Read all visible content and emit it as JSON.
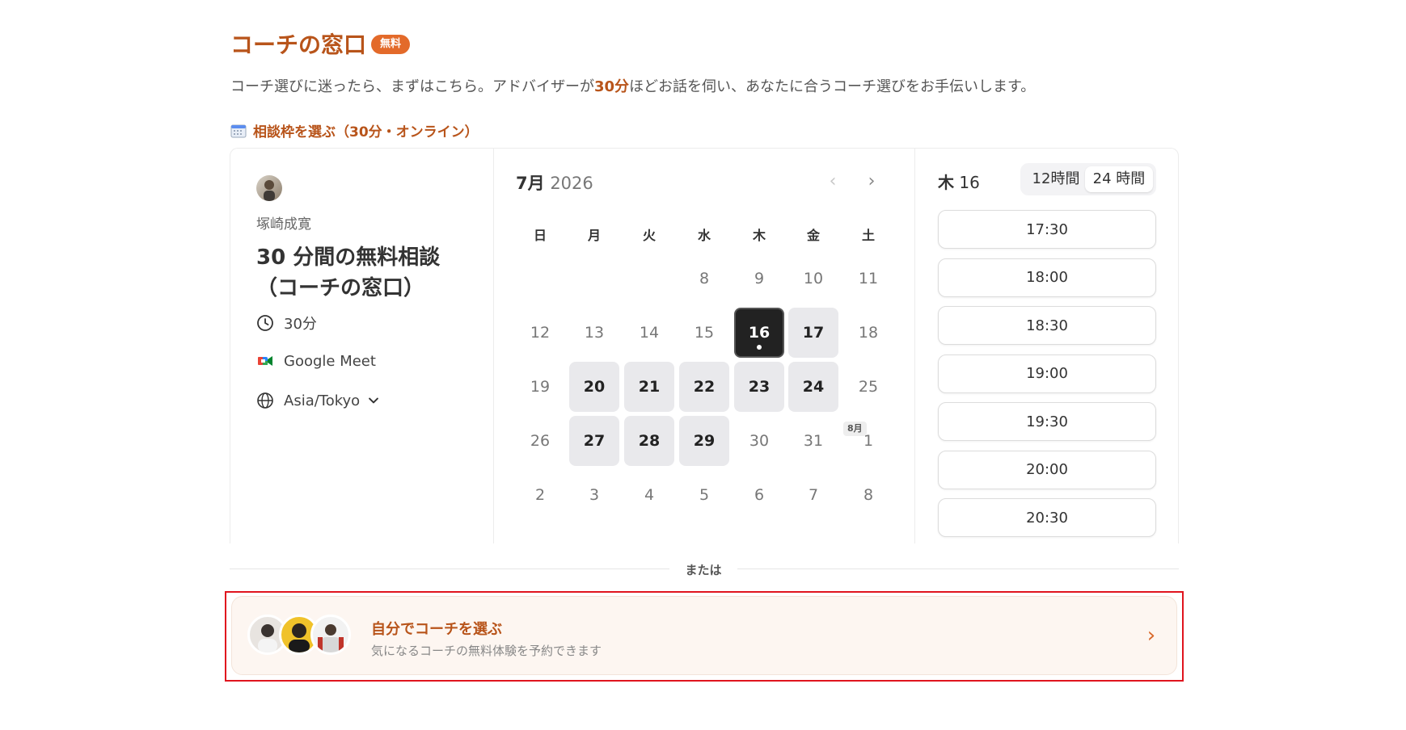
{
  "header": {
    "title": "コーチの窓口",
    "badge": "無料"
  },
  "intro": {
    "before": "コーチ選びに迷ったら、まずはこちら。アドバイザーが",
    "highlight": "30分",
    "after": "ほどお話を伺い、あなたに合うコーチ選びをお手伝いします。"
  },
  "section_label": "相談枠を選ぶ（30分・オンライン）",
  "event": {
    "coach_name": "塚崎成寛",
    "title": "30 分間の無料相談（コーチの窓口）",
    "duration": "30分",
    "location": "Google Meet",
    "timezone": "Asia/Tokyo"
  },
  "calendar": {
    "month": "7月",
    "year": "2026",
    "weekdays": [
      "日",
      "月",
      "火",
      "水",
      "木",
      "金",
      "土"
    ],
    "next_month_tag": "8月",
    "weeks": [
      [
        "",
        "",
        "",
        "8",
        "9",
        "10",
        "11"
      ],
      [
        "12",
        "13",
        "14",
        "15",
        "16",
        "17",
        "18"
      ],
      [
        "19",
        "20",
        "21",
        "22",
        "23",
        "24",
        "25"
      ],
      [
        "26",
        "27",
        "28",
        "29",
        "30",
        "31",
        "1"
      ],
      [
        "2",
        "3",
        "4",
        "5",
        "6",
        "7",
        "8"
      ]
    ],
    "available": [
      "17",
      "20",
      "21",
      "22",
      "23",
      "24",
      "27",
      "28",
      "29"
    ],
    "selected": "16"
  },
  "times": {
    "selected_weekday": "木",
    "selected_day": "16",
    "format_12h": "12時間",
    "format_24h": "24 時間",
    "active_format": "24h",
    "slots": [
      "17:30",
      "18:00",
      "18:30",
      "19:00",
      "19:30",
      "20:00",
      "20:30"
    ]
  },
  "divider_text": "または",
  "cta": {
    "title": "自分でコーチを選ぶ",
    "subtitle": "気になるコーチの無料体験を予約できます"
  },
  "colors": {
    "accent": "#b8541a",
    "badge": "#e36a2a",
    "highlight_border": "#e0141e"
  }
}
